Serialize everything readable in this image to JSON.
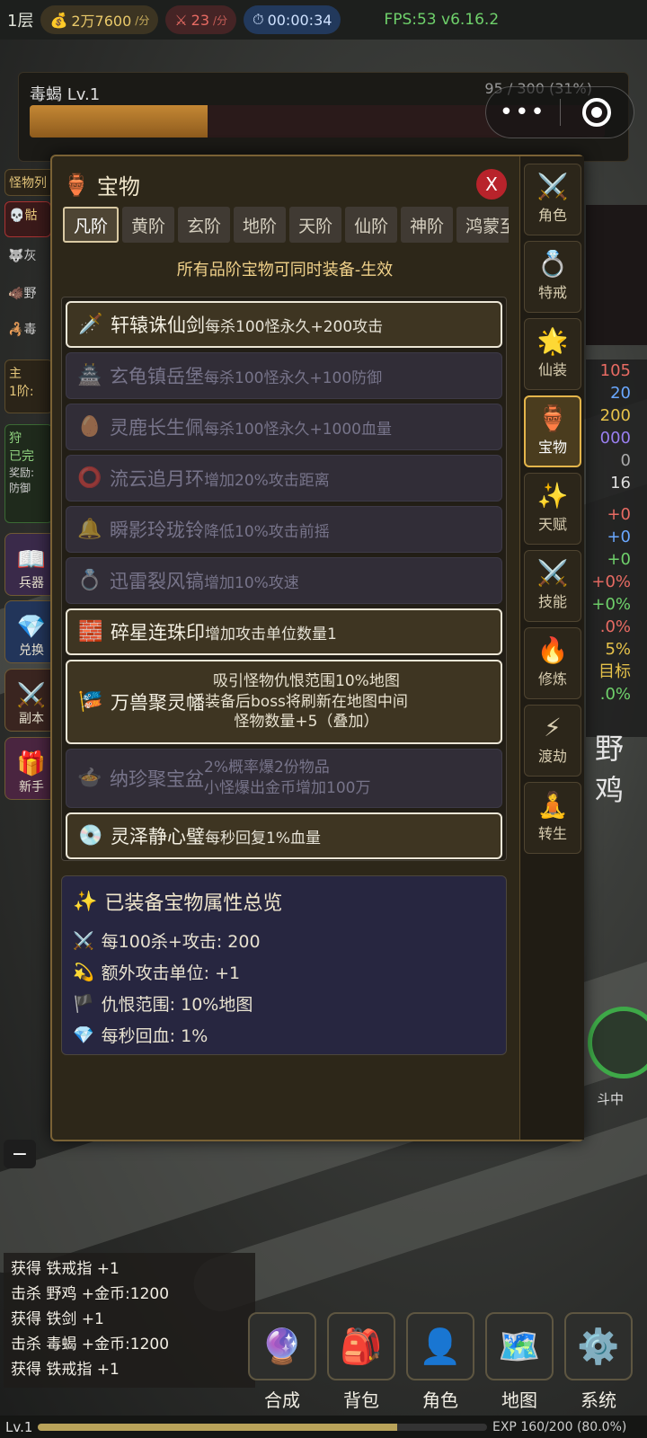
{
  "topbar": {
    "floor": "1层",
    "gold": "2万7600",
    "gold_unit": "/分",
    "kills": "23",
    "kills_unit": "/分",
    "timer": "00:00:34",
    "fps": "FPS:53 v6.16.2"
  },
  "monster": {
    "name": "毒蝎 Lv.1",
    "hp_text": "95 / 300 (31%)",
    "hp_fraction": 0.31
  },
  "side": {
    "monster_list_label": "怪物列",
    "monsters": [
      "骷",
      "灰",
      "野",
      "毒"
    ],
    "quest_label": "主",
    "quest_progress": "1阶:",
    "hunt_label": "狩",
    "hunt_status": "已完",
    "hunt_reward": "奖励:",
    "hunt_type": "防御",
    "buttons": [
      "兵器",
      "兑换",
      "副本",
      "新手"
    ]
  },
  "stats_right": [
    "105",
    "20",
    "200",
    "000",
    "0",
    "16",
    "+0",
    "+0",
    "+0",
    "+0%",
    "+0%",
    ".0%",
    "5%",
    "目标",
    ".0%"
  ],
  "enemy_label": "野鸡",
  "battle_label": "斗中",
  "panel": {
    "title": "宝物",
    "close": "X",
    "tabs": [
      "凡阶",
      "黄阶",
      "玄阶",
      "地阶",
      "天阶",
      "仙阶",
      "神阶",
      "鸿蒙至宝"
    ],
    "note": "所有品阶宝物可同时装备-生效",
    "items": [
      {
        "name": "轩辕诛仙剑",
        "effect": "每杀100怪永久+200攻击",
        "equipped": true,
        "icon": "🗡️"
      },
      {
        "name": "玄龟镇岳堡",
        "effect": "每杀100怪永久+100防御",
        "equipped": false,
        "icon": "🏯"
      },
      {
        "name": "灵鹿长生佩",
        "effect": "每杀100怪永久+1000血量",
        "equipped": false,
        "icon": "🥚"
      },
      {
        "name": "流云追月环",
        "effect": "增加20%攻击距离",
        "equipped": false,
        "icon": "⭕"
      },
      {
        "name": "瞬影玲珑铃",
        "effect": "降低10%攻击前摇",
        "equipped": false,
        "icon": "🔔"
      },
      {
        "name": "迅雷裂风镐",
        "effect": "增加10%攻速",
        "equipped": false,
        "icon": "💍"
      },
      {
        "name": "碎星连珠印",
        "effect": "增加攻击单位数量1",
        "equipped": true,
        "icon": "🧱"
      }
    ],
    "banner": {
      "name": "万兽聚灵幡",
      "lines": [
        "吸引怪物仇恨范围10%地图",
        "装备后boss将刷新在地图中间",
        "怪物数量+5（叠加）"
      ],
      "icon": "🎏"
    },
    "basin": {
      "name": "纳珍聚宝盆",
      "lines": [
        "2%概率爆2份物品",
        "小怪爆出金币增加100万"
      ],
      "icon": "🍲"
    },
    "jade": {
      "name": "灵泽静心璧",
      "effect": "每秒回复1%血量",
      "icon": "💿"
    },
    "summary": {
      "title": "已装备宝物属性总览",
      "rows": [
        {
          "icon": "⚔️",
          "text": "每100杀+攻击: 200"
        },
        {
          "icon": "💫",
          "text": "额外攻击单位: +1"
        },
        {
          "icon": "🏴",
          "text": "仇恨范围: 10%地图"
        },
        {
          "icon": "💎",
          "text": "每秒回血: 1%"
        }
      ]
    },
    "right_tabs": [
      {
        "label": "角色",
        "icon": "⚔️"
      },
      {
        "label": "特戒",
        "icon": "💍"
      },
      {
        "label": "仙装",
        "icon": "🌟"
      },
      {
        "label": "宝物",
        "icon": "🏺",
        "active": true
      },
      {
        "label": "天赋",
        "icon": "✨"
      },
      {
        "label": "技能",
        "icon": "⚔️"
      },
      {
        "label": "修炼",
        "icon": "🔥"
      },
      {
        "label": "渡劫",
        "icon": "⚡"
      },
      {
        "label": "转生",
        "icon": "🧘"
      }
    ]
  },
  "log": [
    "获得 铁戒指 +1",
    "击杀 野鸡 +金币:1200",
    "获得 铁剑 +1",
    "击杀 毒蝎 +金币:1200",
    "获得 铁戒指 +1"
  ],
  "bottom_nav": [
    {
      "label": "合成",
      "icon": "🔮"
    },
    {
      "label": "背包",
      "icon": "🎒"
    },
    {
      "label": "角色",
      "icon": "👤"
    },
    {
      "label": "地图",
      "icon": "🗺️"
    },
    {
      "label": "系统",
      "icon": "⚙️"
    }
  ],
  "exp": {
    "level": "Lv.1",
    "text": "EXP 160/200 (80.0%)",
    "fraction": 0.8
  },
  "zoom_minus": "−"
}
